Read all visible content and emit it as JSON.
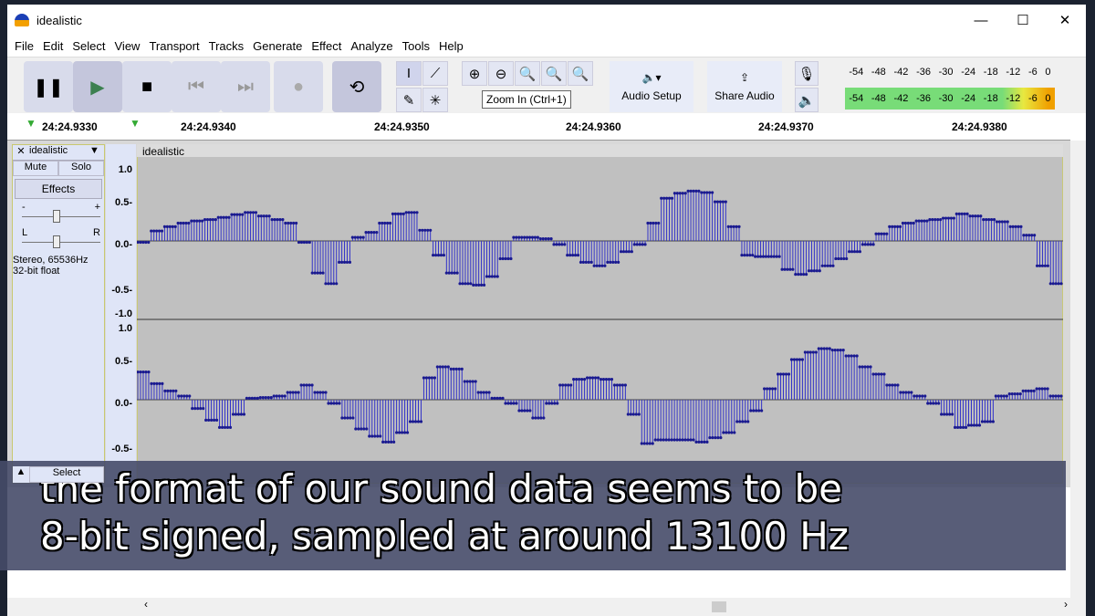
{
  "window": {
    "title": "idealistic",
    "minimize": "—",
    "maximize": "☐",
    "close": "✕"
  },
  "menu": [
    "File",
    "Edit",
    "Select",
    "View",
    "Transport",
    "Tracks",
    "Generate",
    "Effect",
    "Analyze",
    "Tools",
    "Help"
  ],
  "tooltip": "Zoom In (Ctrl+1)",
  "toolbar": {
    "audio_setup": "Audio Setup",
    "share_audio": "Share Audio"
  },
  "meters": {
    "record_ticks": [
      "-54",
      "-48",
      "-42",
      "-36",
      "-30",
      "-24",
      "-18",
      "-12",
      "-6",
      "0"
    ],
    "play_ticks": [
      "-54",
      "-48",
      "-42",
      "-36",
      "-30",
      "-24",
      "-18",
      "-12",
      "-6",
      "0"
    ],
    "L": "L",
    "R": "R"
  },
  "ruler": [
    "24:24.9330",
    "24:24.9340",
    "24:24.9350",
    "24:24.9360",
    "24:24.9370",
    "24:24.9380"
  ],
  "track": {
    "name": "idealistic",
    "clip_name": "idealistic",
    "mute": "Mute",
    "solo": "Solo",
    "effects": "Effects",
    "gain_minus": "-",
    "gain_plus": "+",
    "pan_l": "L",
    "pan_r": "R",
    "format1": "Stereo, 65536Hz",
    "format2": "32-bit float",
    "select": "Select"
  },
  "scale": [
    "1.0",
    "0.5-",
    "0.0-",
    "-0.5-",
    "-1.0"
  ],
  "colors": {
    "wave": "#3232c8",
    "selection": "#c8c878"
  },
  "waveform": {
    "left": [
      -0.02,
      0.14,
      0.2,
      0.25,
      0.28,
      0.3,
      0.33,
      0.37,
      0.4,
      0.35,
      0.3,
      0.25,
      -0.02,
      -0.45,
      -0.6,
      -0.3,
      0.05,
      0.12,
      0.25,
      0.38,
      0.4,
      0.15,
      -0.2,
      -0.45,
      -0.6,
      -0.62,
      -0.5,
      -0.25,
      0.05,
      0.05,
      0.03,
      -0.05,
      -0.2,
      -0.3,
      -0.35,
      -0.3,
      -0.15,
      -0.05,
      0.25,
      0.6,
      0.67,
      0.7,
      0.68,
      0.55,
      0.2,
      -0.2,
      -0.22,
      -0.22,
      -0.4,
      -0.47,
      -0.42,
      -0.35,
      -0.25,
      -0.15,
      -0.05,
      0.1,
      0.2,
      0.25,
      0.28,
      0.3,
      0.32,
      0.38,
      0.35,
      0.3,
      0.27,
      0.2,
      0.08,
      -0.35,
      -0.6
    ],
    "right": [
      0.38,
      0.22,
      0.12,
      0.05,
      -0.12,
      -0.28,
      -0.38,
      -0.2,
      0.02,
      0.03,
      0.05,
      0.1,
      0.2,
      0.1,
      -0.05,
      -0.25,
      -0.4,
      -0.5,
      -0.58,
      -0.45,
      -0.3,
      0.3,
      0.45,
      0.42,
      0.25,
      0.1,
      0.02,
      -0.05,
      -0.15,
      -0.25,
      -0.05,
      0.2,
      0.28,
      0.3,
      0.28,
      0.2,
      -0.2,
      -0.6,
      -0.55,
      -0.55,
      -0.55,
      -0.58,
      -0.52,
      -0.45,
      -0.3,
      -0.15,
      0.15,
      0.35,
      0.55,
      0.65,
      0.7,
      0.68,
      0.6,
      0.45,
      0.35,
      0.2,
      0.1,
      0.05,
      -0.05,
      -0.2,
      -0.38,
      -0.35,
      -0.3,
      0.05,
      0.08,
      0.12,
      0.15,
      0.05
    ]
  },
  "caption": {
    "line1": "the format of our sound data seems to be",
    "line2": "8-bit signed, sampled at around 13100 Hz"
  }
}
